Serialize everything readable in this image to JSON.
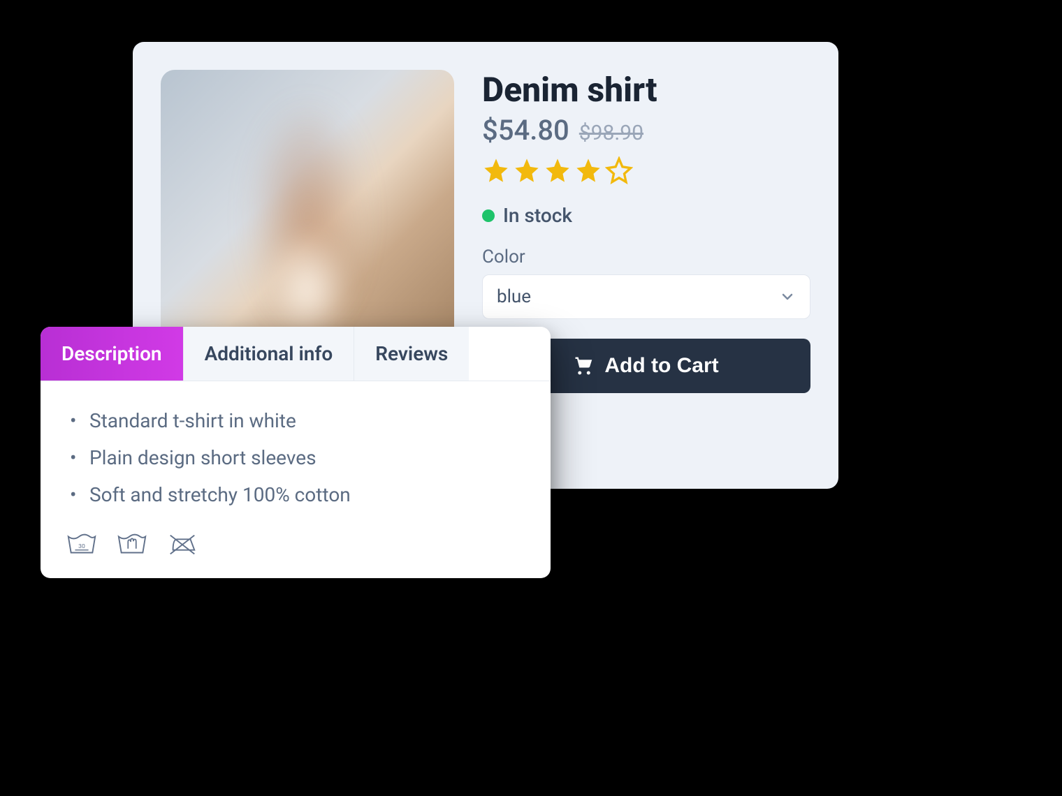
{
  "product": {
    "title": "Denim shirt",
    "price": "$54.80",
    "price_old": "$98.90",
    "rating": 4,
    "rating_max": 5,
    "stock_status": "In stock",
    "stock_color": "#1ec36a",
    "color_label": "Color",
    "color_selected": "blue",
    "add_to_cart_label": "Add to Cart"
  },
  "tabs": {
    "items": [
      "Description",
      "Additional info",
      "Reviews"
    ],
    "active_index": 0
  },
  "description": {
    "bullets": [
      "Standard t-shirt in white",
      "Plain design short sleeves",
      "Soft and stretchy 100% cotton"
    ]
  },
  "care_icons": [
    "wash-30",
    "hand-wash",
    "do-not-iron"
  ],
  "colors": {
    "accent": "#c030d8",
    "star": "#f2b90d",
    "dark_button": "#263244"
  }
}
